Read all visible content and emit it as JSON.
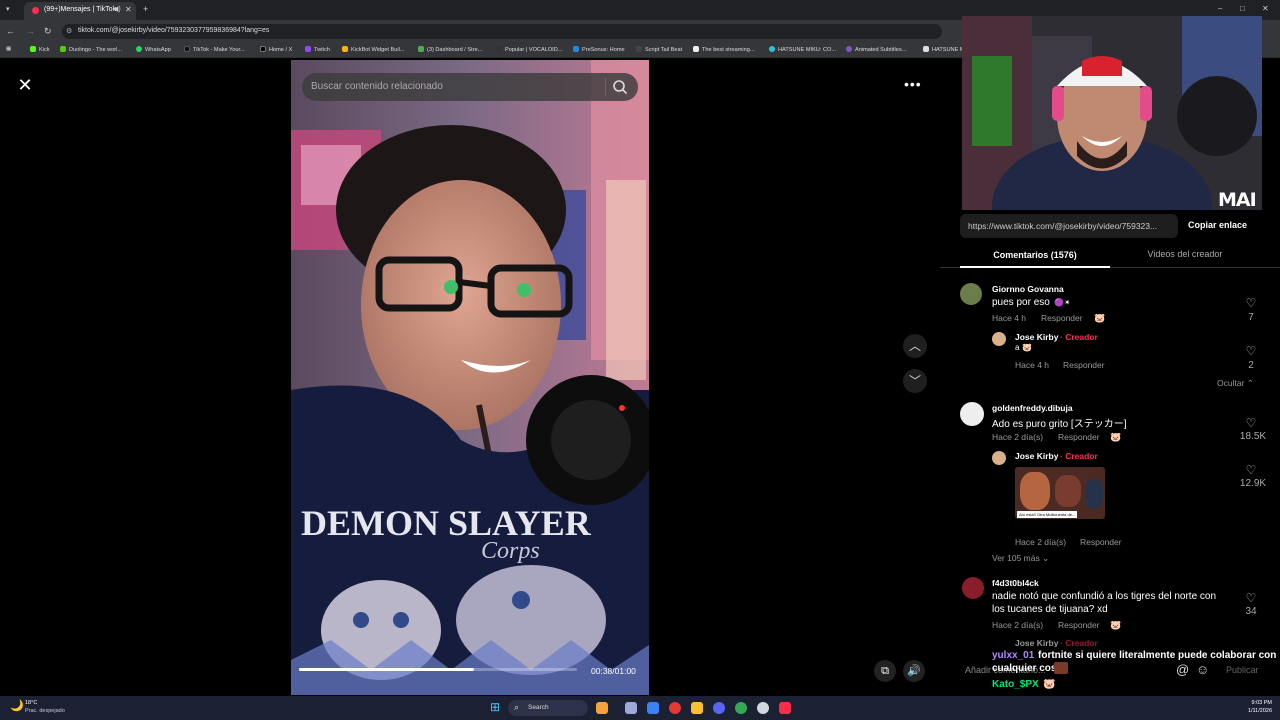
{
  "browser": {
    "tab_title": "(99+)Mensajes | TikTok",
    "url": "tiktok.com/@josekirby/video/7593230377959836984?lang=es",
    "bookmarks": [
      "Kick",
      "Duolingo - The worl...",
      "WhatsApp",
      "TikTok - Make Your...",
      "Home / X",
      "Twitch",
      "KickBot Widget Buil...",
      "(3) Dashboard / Stre...",
      "Popular | VOCALOID...",
      "PreSonus: Home",
      "Script Tail Beat",
      "The best streaming...",
      "HATSUNE MIKU: CO...",
      "Animated Subtitles...",
      "HATSUNE M"
    ]
  },
  "video": {
    "search_placeholder": "Buscar contenido relacionado",
    "time": "00:38/01:00",
    "progress": 0.63,
    "shirt_text": "DEMON SLAYER",
    "shirt_text2": "Corps"
  },
  "panel": {
    "link": "https://www.tiktok.com/@josekirby/video/759323...",
    "copy_label": "Copiar enlace",
    "tab_comments": "Comentarios (1576)",
    "tab_videos": "Videos del creador",
    "cam_logo": "MAI",
    "comments": [
      {
        "name": "Giornno Govanna",
        "text": "pues por eso",
        "time": "Hace 4 h",
        "reply": "Responder",
        "likes": "7"
      },
      {
        "name": "Jose Kirby",
        "creator": "· Creador",
        "text": "a",
        "time": "Hace 4 h",
        "reply": "Responder",
        "likes": "2"
      },
      {
        "hide": "Ocultar"
      },
      {
        "name": "goldenfreddy.dibuja",
        "text": "Ado es puro grito [ステッカー]",
        "time": "Hace 2 día(s)",
        "reply": "Responder",
        "likes": "18.5K"
      },
      {
        "name": "Jose Kirby",
        "creator": "· Creador",
        "time": "Hace 2 día(s)",
        "reply": "Responder",
        "likes": "12.9K",
        "sticker_caption": "Ahí está!! Otra Multicuenta de..."
      },
      {
        "more": "Ver 105 más"
      },
      {
        "name": "f4d3t0bl4ck",
        "text": "nadie notó que confundió a los tigres del norte con",
        "text2": "los tucanes de tijuana? xd",
        "time": "Hace 2 día(s)",
        "reply": "Responder",
        "likes": "34"
      },
      {
        "name": "Jose Kirby",
        "creator": "· Creador"
      }
    ],
    "add_comment": "Añadir comentario...",
    "publish": "Publicar"
  },
  "chat": [
    {
      "user": "yulxx_01",
      "msg": "fortnite si quiere literalmente puede colaborar con",
      "msg2": "cualquier cosa",
      "color": "#b388ff"
    },
    {
      "user": "Kato_$PX",
      "msg": "",
      "color": "#00e676"
    }
  ],
  "taskbar": {
    "weather_temp": "18°C",
    "weather_desc": "Prac. despejado",
    "search": "Search",
    "clock_time": "9:03 PM",
    "clock_date": "1/11/2026"
  },
  "colors": {
    "accent": "#fe2c55",
    "background": "#000000",
    "panel_text": "#ffffff"
  }
}
